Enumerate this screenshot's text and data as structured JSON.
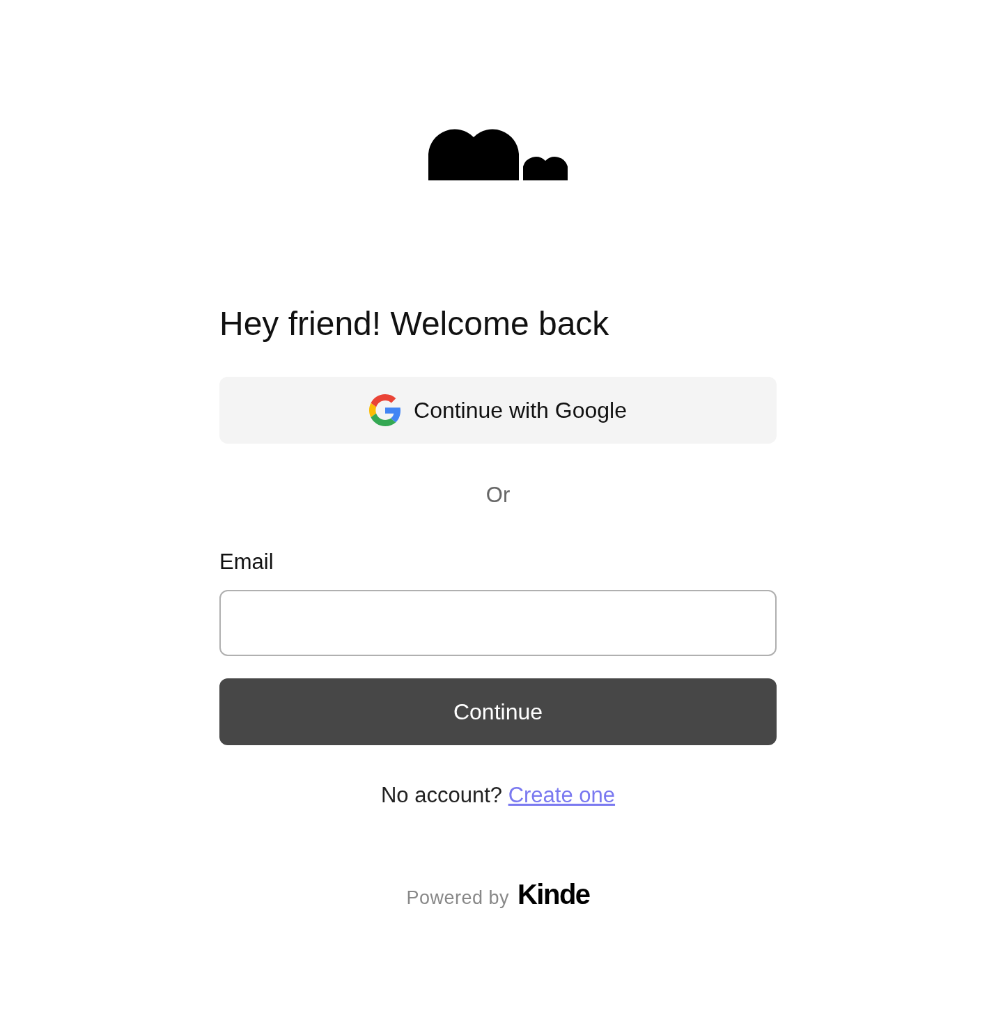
{
  "heading": "Hey friend! Welcome back",
  "social_button": {
    "label": "Continue with Google"
  },
  "divider_text": "Or",
  "email": {
    "label": "Email"
  },
  "submit_button": {
    "label": "Continue"
  },
  "signup": {
    "prompt": "No account?",
    "link": "Create one"
  },
  "footer": {
    "powered_by": "Powered by",
    "brand": "Kinde"
  }
}
